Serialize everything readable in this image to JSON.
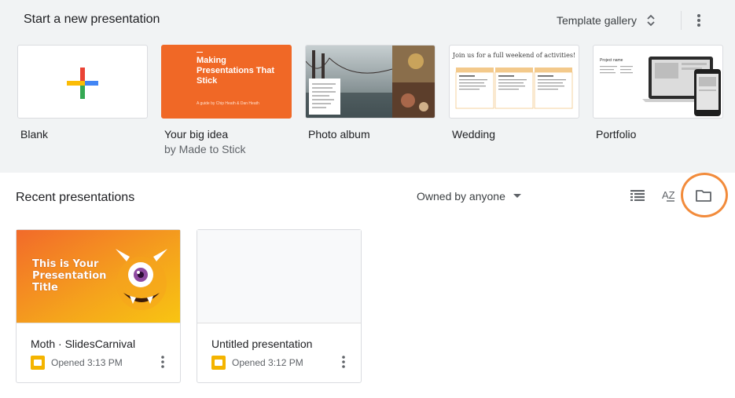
{
  "header": {
    "title": "Start a new presentation",
    "template_gallery_label": "Template gallery"
  },
  "templates": [
    {
      "name": "Blank",
      "subtitle": ""
    },
    {
      "name": "Your big idea",
      "subtitle": "by Made to Stick",
      "thumb_title": "Making Presentations That Stick",
      "thumb_sub": "A guide by Chip Heath & Dan Heath"
    },
    {
      "name": "Photo album",
      "subtitle": ""
    },
    {
      "name": "Wedding",
      "subtitle": "",
      "thumb_title": "Join us for a full weekend of activities!"
    },
    {
      "name": "Portfolio",
      "subtitle": "",
      "thumb_title": "Project name"
    }
  ],
  "recent": {
    "title": "Recent presentations",
    "owner_filter": "Owned by anyone",
    "sort_label": "AZ"
  },
  "files": [
    {
      "title": "Moth · SlidesCarnival",
      "opened": "Opened 3:13 PM",
      "thumb_text": "This is Your Presentation Title"
    },
    {
      "title": "Untitled presentation",
      "opened": "Opened 3:12 PM"
    }
  ],
  "colors": {
    "template_bg": "#f1f3f4",
    "highlight": "#f28b3b",
    "slides_yellow": "#f4b400",
    "big_idea_orange": "#f06826"
  }
}
